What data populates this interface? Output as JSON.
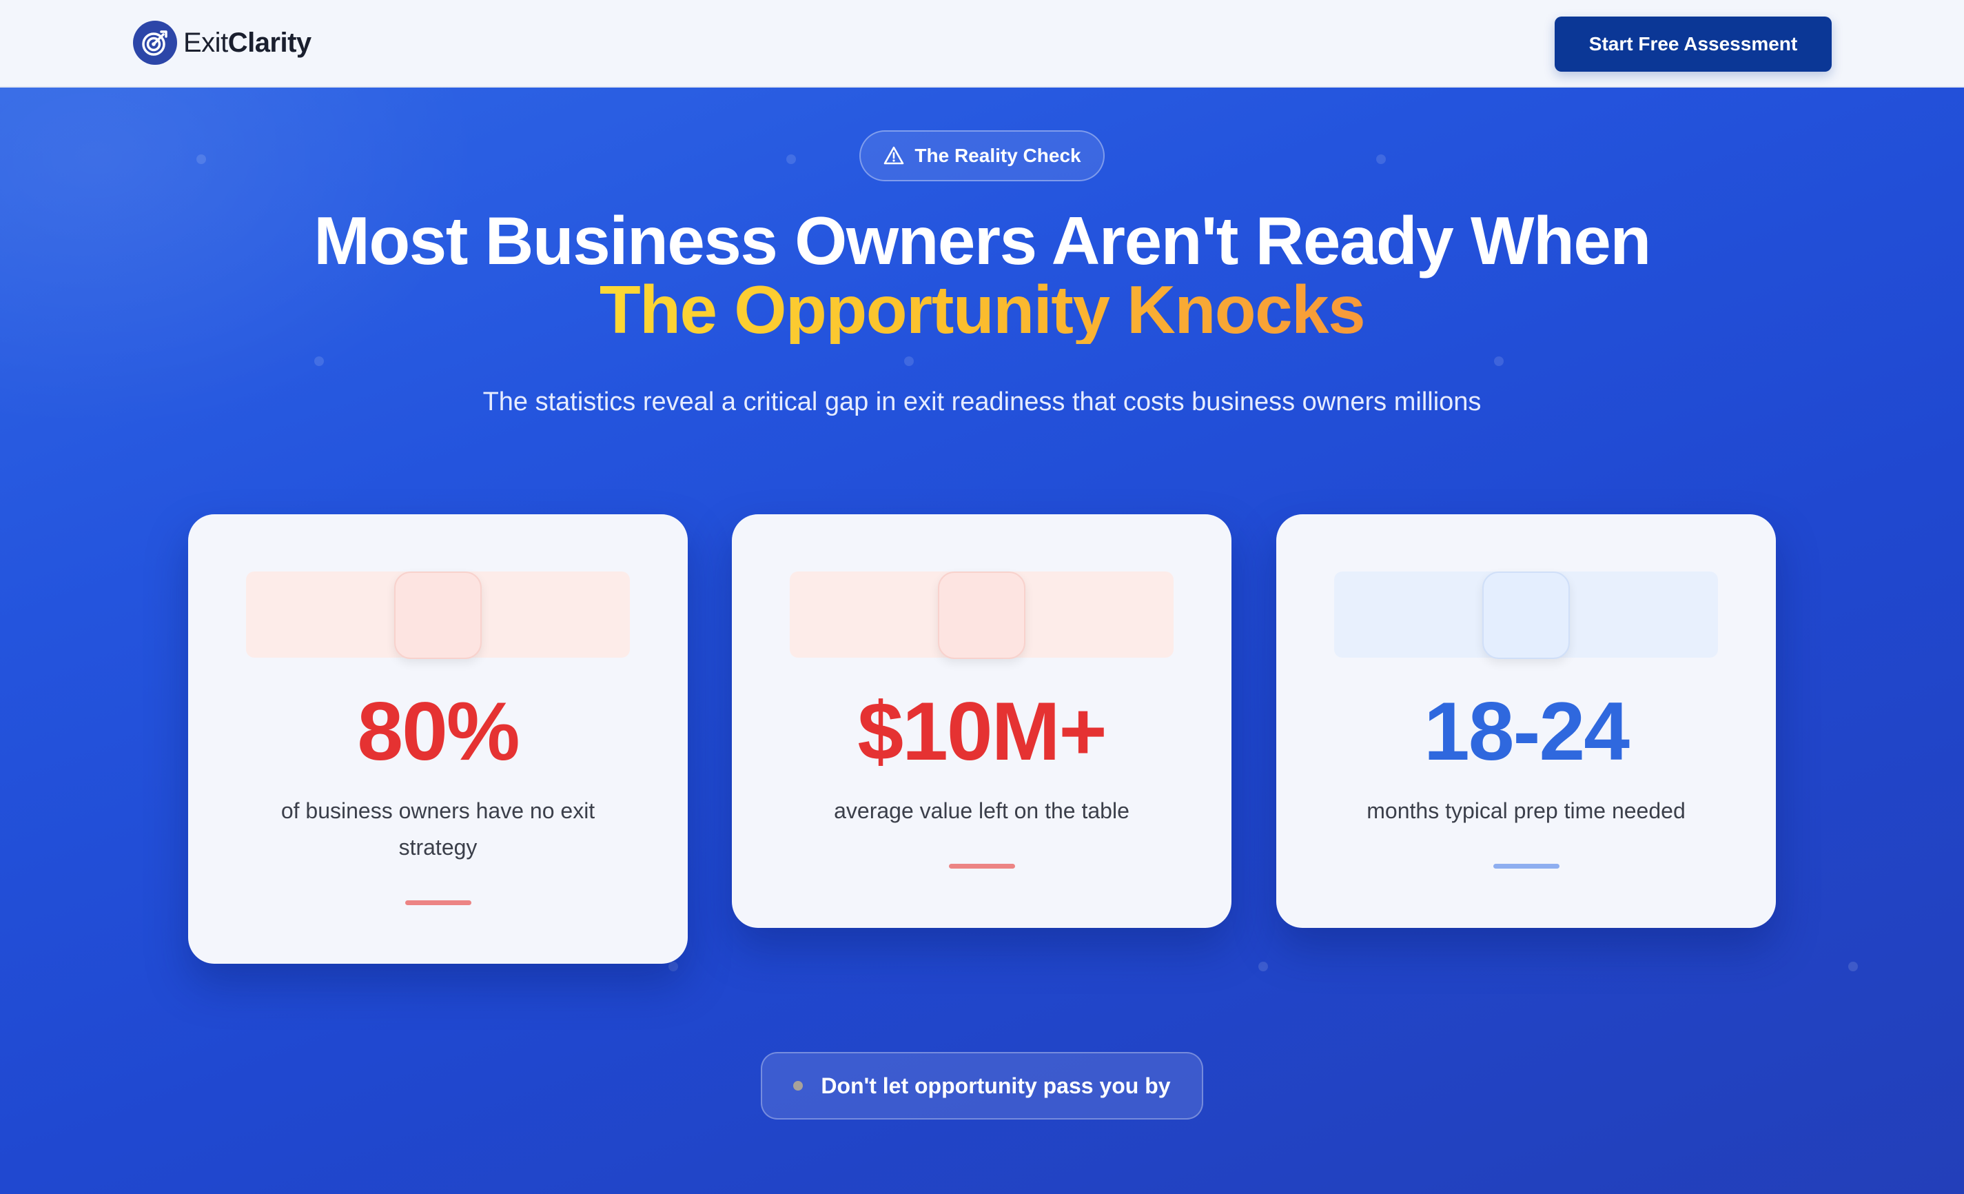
{
  "nav": {
    "brand_prefix": "Exit",
    "brand_bold": "Clarity",
    "logo_icon": "target-icon",
    "cta_label": "Start Free Assessment"
  },
  "hero": {
    "badge_icon": "warning-triangle-icon",
    "badge_label": "The Reality Check",
    "headline_line1": "Most Business Owners Aren't Ready When",
    "headline_line2": "The Opportunity Knocks",
    "subheadline": "The statistics reveal a critical gap in exit readiness that costs business owners millions",
    "footer_note": "Don't let opportunity pass you by"
  },
  "stats": [
    {
      "value": "80%",
      "description": "of business owners have no exit strategy",
      "accent": "#e53232"
    },
    {
      "value": "$10M+",
      "description": "average value left on the table",
      "accent": "#e53232"
    },
    {
      "value": "18-24",
      "description": "months typical prep time needed",
      "accent": "#2f68de"
    }
  ],
  "colors": {
    "brand_dark": "#0b3796",
    "hero_blue": "#2454dd",
    "headline_gradient_start": "#fcd835",
    "headline_gradient_end": "#f79a3a"
  }
}
